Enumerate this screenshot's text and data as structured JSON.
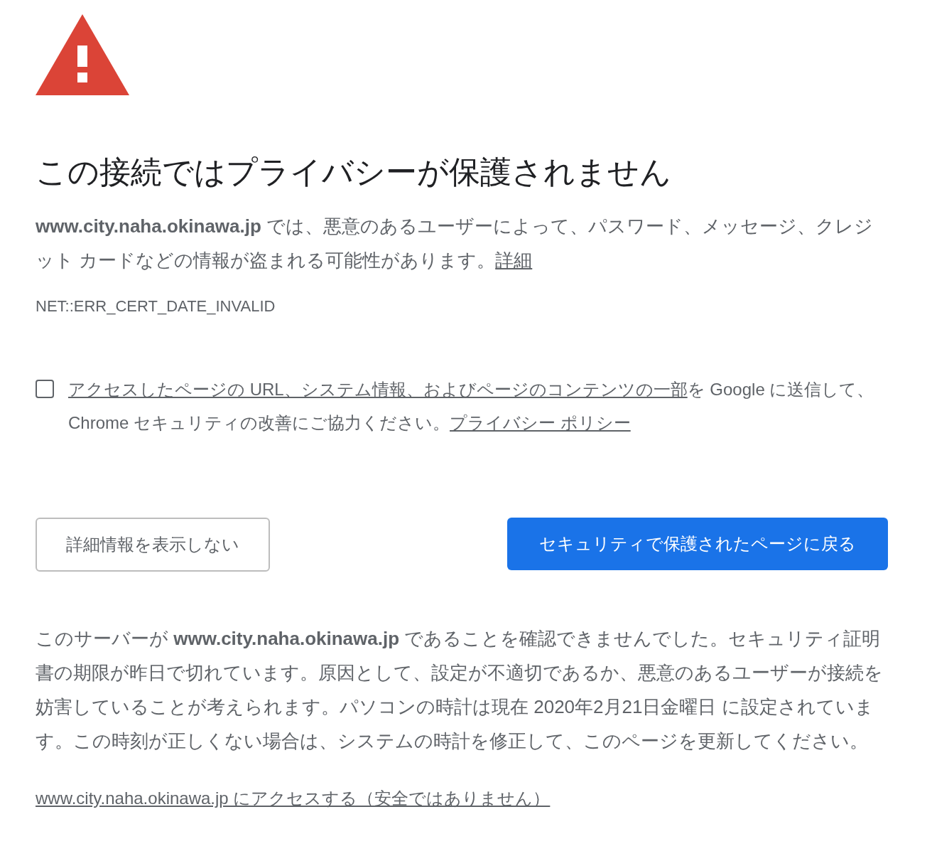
{
  "heading": "この接続ではプライバシーが保護されません",
  "description": {
    "text": "**www.city.naha.okinawa.jp** では、悪意のあるユーザーによって、パスワード、メッセージ、クレジット カードなどの情報が盗まれる可能性があります。",
    "link": "詳細"
  },
  "error_code": "NET::ERR_CERT_DATE_INVALID",
  "report_checkbox": {
    "checked": false,
    "link": "アクセスしたページの URL、システム情報、およびページのコンテンツの一部",
    "text": "を Google に送信して、Chrome セキュリティの改善にご協力ください。",
    "policy_link": "プライバシー ポリシー"
  },
  "buttons": [
    {
      "label": "詳細情報を表示しない",
      "kind": "secondary"
    },
    {
      "label": "セキュリティで保護されたページに戻る",
      "kind": "primary"
    }
  ],
  "details": "このサーバーが **www.city.naha.okinawa.jp** であることを確認できませんでした。セキュリティ証明書の期限が昨日で切れています。原因として、設定が不適切であるか、悪意のあるユーザーが接続を妨害していることが考えられます。パソコンの時計は現在 2020年2月21日金曜日 に設定されています。この時刻が正しくない場合は、システムの時計を修正して、このページを更新してください。",
  "proceed_link": "www.city.naha.okinawa.jp にアクセスする（安全ではありません）"
}
